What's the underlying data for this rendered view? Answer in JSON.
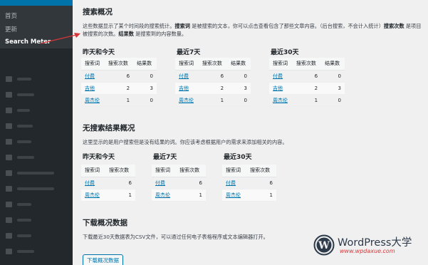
{
  "sidebar": {
    "submenu": [
      {
        "label": "首页",
        "current": false
      },
      {
        "label": "更新",
        "current": false
      },
      {
        "label": "Search Meter",
        "current": true
      }
    ]
  },
  "summary": {
    "title": "搜索概况",
    "desc_part1": "这些数据显示了某个时间段的搜索统计。",
    "desc_term1": "搜索词",
    "desc_part2": " 是被搜索的文本，你可以点击查看包含了那些文章内容。（后台搜索，不会计入统计）",
    "desc_term2": "搜索次数",
    "desc_part3": " 是项目被搜索的次数。",
    "desc_term3": "结果数",
    "desc_part4": " 是搜索到的内容数量。",
    "columns": [
      {
        "title": "昨天和今天",
        "headers": [
          "搜索词",
          "搜索次数",
          "结果数"
        ],
        "rows": [
          {
            "term": "付费",
            "count": "6",
            "results": "0"
          },
          {
            "term": "吉他",
            "count": "2",
            "results": "3"
          },
          {
            "term": "周杰伦",
            "count": "1",
            "results": "0"
          }
        ]
      },
      {
        "title": "最近7天",
        "headers": [
          "搜索词",
          "搜索次数",
          "结果数"
        ],
        "rows": [
          {
            "term": "付费",
            "count": "6",
            "results": "0"
          },
          {
            "term": "吉他",
            "count": "2",
            "results": "3"
          },
          {
            "term": "周杰伦",
            "count": "1",
            "results": "0"
          }
        ]
      },
      {
        "title": "最近30天",
        "headers": [
          "搜索词",
          "搜索次数",
          "结果数"
        ],
        "rows": [
          {
            "term": "付费",
            "count": "6",
            "results": "0"
          },
          {
            "term": "吉他",
            "count": "2",
            "results": "3"
          },
          {
            "term": "周杰伦",
            "count": "1",
            "results": "0"
          }
        ]
      }
    ]
  },
  "noresults": {
    "title": "无搜索结果概况",
    "desc": "这里显示的是用户搜索但是没有结果的词。你应该考虑根据用户的需求来添加相关的内容。",
    "columns": [
      {
        "title": "昨天和今天",
        "headers": [
          "搜索词",
          "搜索次数"
        ],
        "rows": [
          {
            "term": "付费",
            "count": "6"
          },
          {
            "term": "周杰伦",
            "count": "1"
          }
        ]
      },
      {
        "title": "最近7天",
        "headers": [
          "搜索词",
          "搜索次数"
        ],
        "rows": [
          {
            "term": "付费",
            "count": "6"
          },
          {
            "term": "周杰伦",
            "count": "1"
          }
        ]
      },
      {
        "title": "最近30天",
        "headers": [
          "搜索词",
          "搜索次数"
        ],
        "rows": [
          {
            "term": "付费",
            "count": "6"
          },
          {
            "term": "周杰伦",
            "count": "1"
          }
        ]
      }
    ]
  },
  "download": {
    "title": "下载概况数据",
    "desc": "下载最近30天数据表为CSV文件，可以通过任何电子表格程序或文本编辑器打开。",
    "button_label": "下载概况数据"
  },
  "watermark": {
    "title": "WordPress大学",
    "url": "www.wpdaxue.com"
  },
  "colors": {
    "sidebar_bg": "#23282d",
    "submenu_bg": "#32373c",
    "link": "#0073aa",
    "arrow": "#d63638"
  }
}
